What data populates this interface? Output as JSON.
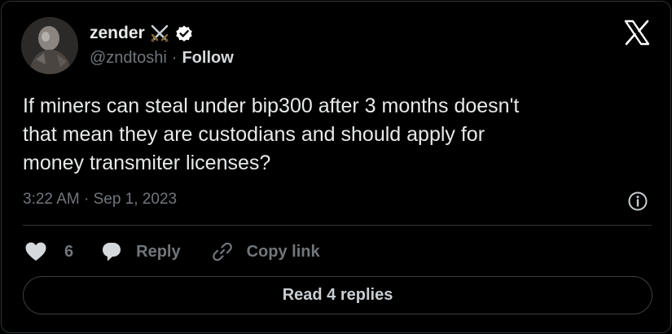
{
  "author": {
    "display_name": "zender",
    "handle": "@zndtoshi",
    "separator": "·",
    "follow_label": "Follow",
    "badges": [
      "crossed-swords-emoji",
      "verified-badge-icon"
    ]
  },
  "tweet": {
    "text": "If miners can steal under bip300 after 3 months doesn't\nthat mean they are custodians and should apply for\nmoney transmiter licenses?",
    "timestamp": "3:22 AM · Sep 1, 2023"
  },
  "actions": {
    "like_count": "6",
    "reply_label": "Reply",
    "copy_link_label": "Copy link"
  },
  "footer": {
    "read_replies_label": "Read 4 replies"
  },
  "icons": {
    "brand": "x-logo-icon",
    "info": "info-icon",
    "like": "heart-icon",
    "reply": "speech-bubble-icon",
    "copy": "link-icon"
  },
  "colors": {
    "background": "#000000",
    "text_primary": "#e7e9ea",
    "text_secondary": "#71767b",
    "border": "#2f3336"
  }
}
